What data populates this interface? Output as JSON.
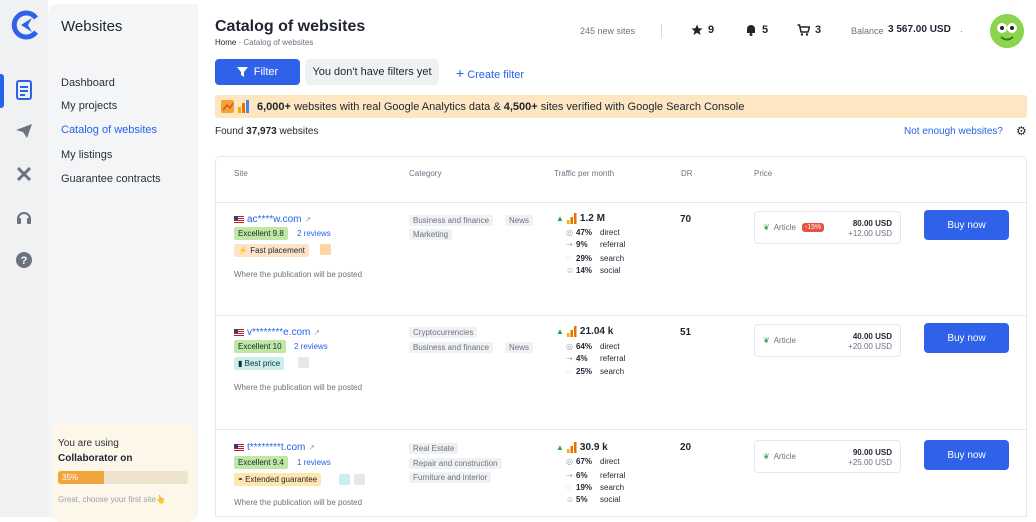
{
  "brand": {
    "accent": "#2f62e9",
    "logo": "brand-logo-icon"
  },
  "sidebar": {
    "title": "Websites",
    "items": [
      {
        "label": "Dashboard"
      },
      {
        "label": "My projects"
      },
      {
        "label": "Catalog of websites",
        "active": true
      },
      {
        "label": "My listings"
      },
      {
        "label": "Guarantee contracts"
      }
    ],
    "collab": {
      "line1": "You are using",
      "line2": "Collaborator on",
      "progress_percent": 35,
      "progress_label": "35%",
      "hint": "Great, choose your first site👆"
    }
  },
  "header": {
    "title": "Catalog of websites",
    "breadcrumb": {
      "home": "Home",
      "sep": "·",
      "current": "Catalog of websites"
    },
    "new_sites": "245 new sites",
    "favorites": "9",
    "watching": "5",
    "cart": "3",
    "balance_label": "Balance",
    "balance_value": "3 567.00 USD",
    "balance_more": "·"
  },
  "filters": {
    "filter_label": "Filter",
    "no_filters": "You don't have filters yet",
    "create_label": "Create filter"
  },
  "banner": {
    "part1": "6,000+",
    "part2": " websites with real Google Analytics data & ",
    "part3": "4,500+",
    "part4": " sites verified with Google Search Console"
  },
  "found": {
    "prefix": "Found ",
    "count": "37,973",
    "suffix": " websites",
    "not_enough": "Not enough websites?"
  },
  "table": {
    "columns": [
      "Site",
      "Category",
      "Traffic per month",
      "DR",
      "Price"
    ],
    "rows": [
      {
        "site": "ac****w.com",
        "rating": "Excellent 9.8",
        "reviews": "2 reviews",
        "badge": "Fast placement",
        "badge_color": "#fde3c8",
        "note": "Where the publication will be posted",
        "categories": [
          "Business and finance",
          "News",
          "Marketing"
        ],
        "traffic": "1.2 M",
        "sources": [
          {
            "pct": "47%",
            "name": "direct"
          },
          {
            "pct": "9%",
            "name": "referral"
          },
          {
            "pct": "29%",
            "name": "search"
          },
          {
            "pct": "14%",
            "name": "social"
          }
        ],
        "dr": "70",
        "type": "Article",
        "discount": "-15%",
        "price": "80.00 USD",
        "extra": "+12.00 USD",
        "buy": "Buy now"
      },
      {
        "site": "v********e.com",
        "rating": "Excellent 10",
        "reviews": "2 reviews",
        "badge": "Best price",
        "badge_color": "#c9f0ee",
        "note": "Where the publication will be posted",
        "categories": [
          "Cryptocurrencies",
          "Business and finance",
          "News"
        ],
        "traffic": "21.04 k",
        "sources": [
          {
            "pct": "64%",
            "name": "direct"
          },
          {
            "pct": "4%",
            "name": "referral"
          },
          {
            "pct": "25%",
            "name": "search"
          }
        ],
        "dr": "51",
        "type": "Article",
        "discount": "",
        "price": "40.00 USD",
        "extra": "+20.00 USD",
        "buy": "Buy now"
      },
      {
        "site": "t********t.com",
        "rating": "Excellent 9.4",
        "reviews": "1 reviews",
        "badge": "Extended guarantee",
        "badge_color": "#fde6b0",
        "note": "Where the publication will be posted",
        "categories": [
          "Real Estate",
          "Repair and construction",
          "Furniture and interior"
        ],
        "traffic": "30.9 k",
        "sources": [
          {
            "pct": "67%",
            "name": "direct"
          },
          {
            "pct": "6%",
            "name": "referral"
          },
          {
            "pct": "19%",
            "name": "search"
          },
          {
            "pct": "5%",
            "name": "social"
          }
        ],
        "dr": "20",
        "type": "Article",
        "discount": "",
        "price": "90.00 USD",
        "extra": "+25.00 USD",
        "buy": "Buy now"
      }
    ]
  }
}
